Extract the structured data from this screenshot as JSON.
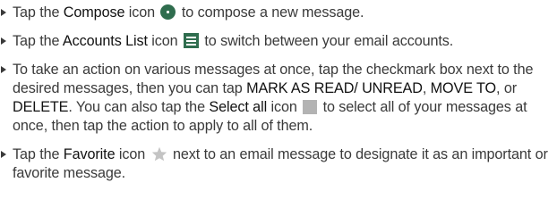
{
  "bullets": [
    {
      "t1": "Tap the ",
      "b1": "Compose",
      "t2": " icon ",
      "t3": " to compose a new message."
    },
    {
      "t1": "Tap the ",
      "b1": "Accounts List",
      "t2": " icon ",
      "t3": " to switch between your email accounts."
    },
    {
      "t1": "To take an action on various messages at once, tap the checkmark box next to the desired messages, then you can tap ",
      "b1": "MARK AS READ/ UNREAD",
      "t2": ", ",
      "b2": "MOVE TO",
      "t3": ", or ",
      "b3": "DELETE",
      "t4": ". You can also tap the ",
      "b4": "Select all",
      "t5": " icon ",
      "t6": " to select all of your messages at once, then tap the action to apply to all of them."
    },
    {
      "t1": "Tap the ",
      "b1": "Favorite",
      "t2": " icon ",
      "t3": " next to an email message to designate it as an important or favorite message."
    }
  ],
  "icons": {
    "compose": "compose-icon",
    "accounts_list": "accounts-list-icon",
    "select_all": "select-all-checkbox-icon",
    "favorite": "favorite-star-icon"
  },
  "colors": {
    "text": "#3a3a3a",
    "icon_green": "#2f6d4e",
    "checkbox_gray": "#b3b3b3",
    "star_gray": "#c4c4c4"
  }
}
